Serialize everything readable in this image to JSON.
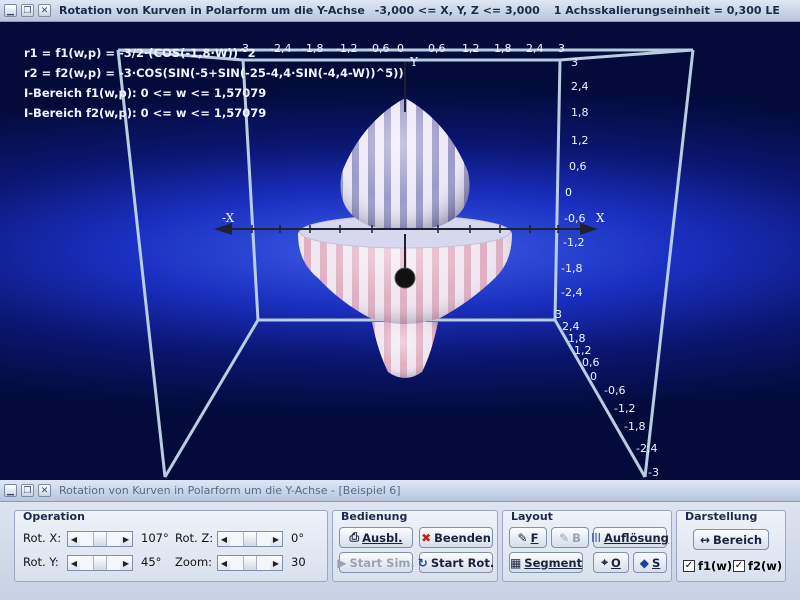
{
  "window": {
    "title": "Rotation von Kurven in Polarform um die Y-Achse",
    "range": "-3,000 <= X, Y, Z <= 3,000",
    "scale": "1 Achsskalierungseinheit = 0,300 LE"
  },
  "info_lines": [
    "r1 = f1(w,p) = -3/2·(COS(-1,8·W))^2",
    "r2 = f2(w,p) = -3·COS(SIN(-5+SIN(-25-4,4·SIN(-4,4-W))^5))",
    "I-Bereich f1(w,p): 0 <= w <= 1,57079",
    "I-Bereich f2(w,p): 0 <= w <= 1,57079"
  ],
  "axes": {
    "x_pos": "X",
    "x_neg": "-X",
    "y": "Y",
    "top_ticks": [
      "-3",
      "-2,4",
      "-1,8",
      "-1,2",
      "-0,6",
      "0",
      "0,6",
      "1,2",
      "1,8",
      "2,4",
      "3"
    ],
    "y_ticks": [
      "3",
      "2,4",
      "1,8",
      "1,2",
      "0,6",
      "0",
      "-0,6",
      "-1,2",
      "-1,8",
      "-2,4",
      "3"
    ],
    "z_ticks": [
      "2,4",
      "1,8",
      "1,2",
      "0,6",
      "0",
      "-0,6",
      "-1,2",
      "-1,8",
      "-2,4",
      "-3"
    ]
  },
  "child_window": {
    "title": "Rotation von Kurven in Polarform um die Y-Achse - [Beispiel 6]"
  },
  "operation": {
    "title": "Operation",
    "rot_x_label": "Rot. X:",
    "rot_x_value": "107°",
    "rot_z_label": "Rot. Z:",
    "rot_z_value": "0°",
    "rot_y_label": "Rot. Y:",
    "rot_y_value": "45°",
    "zoom_label": "Zoom:",
    "zoom_value": "30"
  },
  "bedienung": {
    "title": "Bedienung",
    "ausbl": "Ausbl.",
    "beenden": "Beenden",
    "start_sim": "Start Sim.",
    "start_rot": "Start Rot."
  },
  "layout": {
    "title": "Layout",
    "f": "F",
    "b": "B",
    "aufloesung": "Auflösung",
    "segment": "Segment",
    "o": "O",
    "s": "S"
  },
  "darstellung": {
    "title": "Darstellung",
    "bereich": "Bereich",
    "f1": "f1(w)",
    "f2": "f2(w)"
  },
  "colors": {
    "frame": "#b7cde0",
    "axis": "#1c2230",
    "surface_light": "#e9e4f6",
    "surface_stripe": "#9a98c8",
    "surface_pink": "#e7b8c8"
  }
}
